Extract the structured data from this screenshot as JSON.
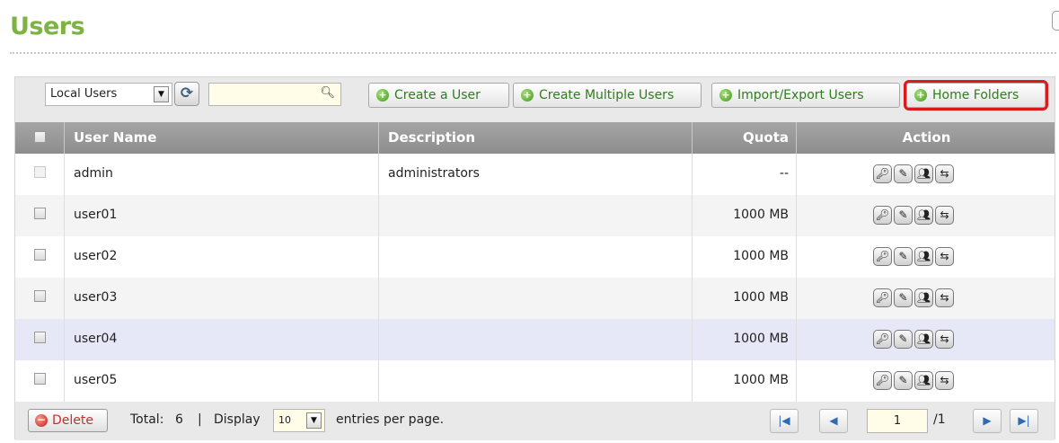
{
  "page": {
    "title": "Users"
  },
  "toolbar": {
    "user_type": "Local Users",
    "search_value": "",
    "buttons": {
      "create_user": "Create a User",
      "create_multiple": "Create Multiple Users",
      "import_export": "Import/Export Users",
      "home_folders": "Home Folders"
    }
  },
  "table": {
    "headers": {
      "username": "User Name",
      "description": "Description",
      "quota": "Quota",
      "action": "Action"
    },
    "rows": [
      {
        "username": "admin",
        "description": "administrators",
        "quota": "--"
      },
      {
        "username": "user01",
        "description": "",
        "quota": "1000 MB"
      },
      {
        "username": "user02",
        "description": "",
        "quota": "1000 MB"
      },
      {
        "username": "user03",
        "description": "",
        "quota": "1000 MB"
      },
      {
        "username": "user04",
        "description": "",
        "quota": "1000 MB"
      },
      {
        "username": "user05",
        "description": "",
        "quota": "1000 MB"
      }
    ],
    "action_icons": [
      "key-icon",
      "edit-icon",
      "group-icon",
      "folder-icon"
    ]
  },
  "footer": {
    "delete_label": "Delete",
    "total_label": "Total:",
    "total_count": "6",
    "separator": "|",
    "display_label": "Display",
    "per_page": "10",
    "entries_label": "entries per page.",
    "current_page": "1",
    "total_pages": "/1"
  },
  "colors": {
    "accent": "#7cb342",
    "header_bg": "#999999",
    "highlight": "#dd1a1a"
  }
}
